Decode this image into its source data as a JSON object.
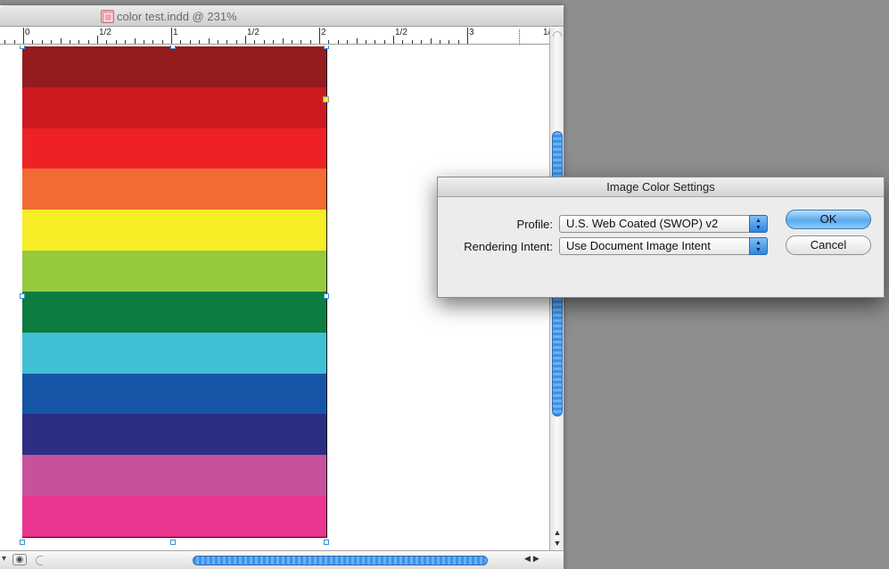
{
  "document_window": {
    "title": "color test.indd @ 231%",
    "ruler_labels": [
      "0",
      "1/2",
      "1",
      "1/2",
      "2",
      "1/2",
      "3",
      "1/"
    ],
    "swatches": [
      "#941b1e",
      "#cd1a21",
      "#ee2226",
      "#f26b35",
      "#f7ec26",
      "#96c93e",
      "#0d7c41",
      "#40c0d4",
      "#1656a6",
      "#2c2e84",
      "#c7519d",
      "#e9368e"
    ]
  },
  "dialog": {
    "title": "Image Color Settings",
    "profile_label": "Profile:",
    "profile_value": "U.S. Web Coated (SWOP) v2",
    "intent_label": "Rendering Intent:",
    "intent_value": "Use Document Image Intent",
    "ok_label": "OK",
    "cancel_label": "Cancel"
  }
}
